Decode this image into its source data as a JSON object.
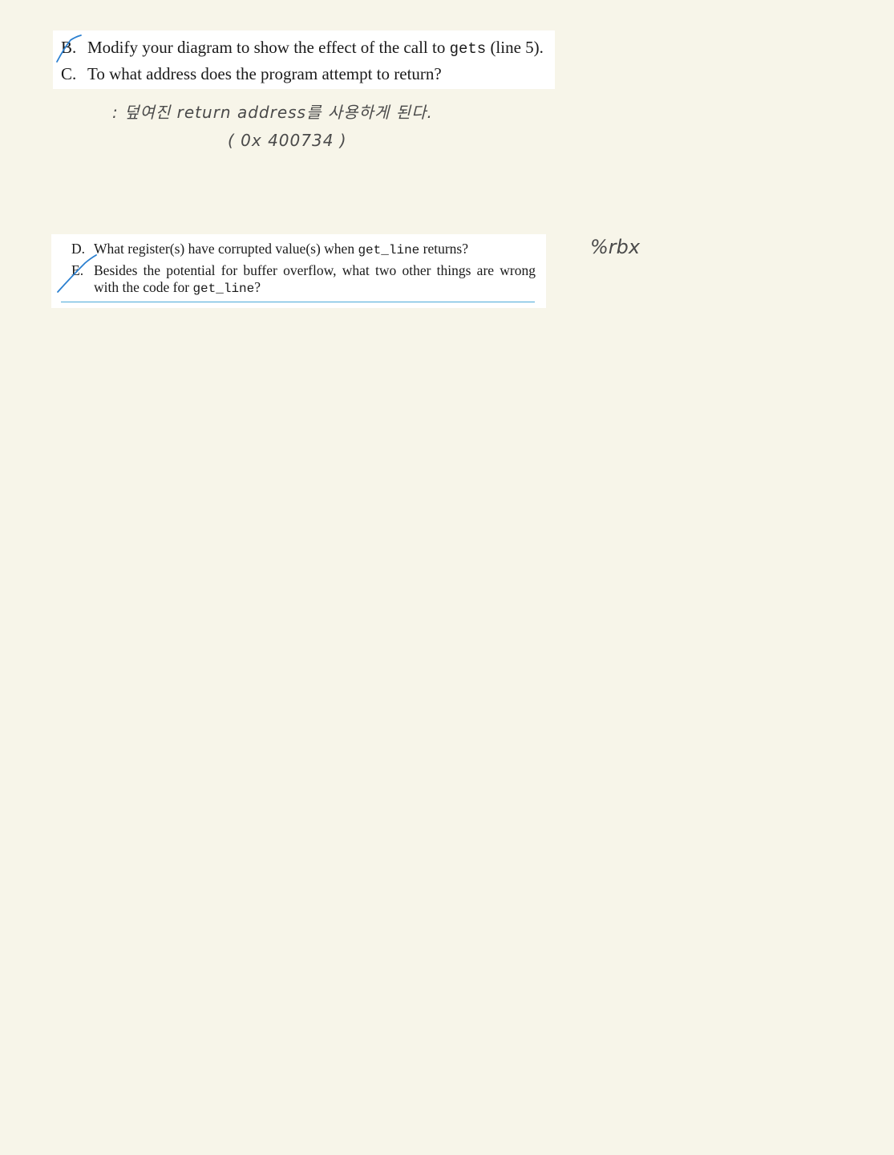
{
  "questions_top": {
    "b": {
      "letter": "B.",
      "text_before": "Modify your diagram to show the effect of the call to ",
      "code": "gets",
      "text_after": " (line 5)."
    },
    "c": {
      "letter": "C.",
      "text": "To what address does the program attempt to return?"
    }
  },
  "answer_c": {
    "line1": ": 덮여진 return address를 사용하게 된다.",
    "line2": "( 0x 400734 )"
  },
  "questions_bottom": {
    "d": {
      "letter": "D.",
      "text_before": "What register(s) have corrupted value(s) when ",
      "code": "get_line",
      "text_after": " returns?"
    },
    "e": {
      "letter": "E.",
      "text_before": "Besides the potential for buffer overflow, what two other things are wrong with the code for ",
      "code": "get_line",
      "text_after": "?"
    }
  },
  "answer_d": {
    "text": "%rbx"
  },
  "colors": {
    "page_background": "#f7f5e9",
    "card_background": "#ffffff",
    "check_mark": "#2a7fd0",
    "rule": "#4aa8d8",
    "handwriting": "#4a4a4a"
  }
}
